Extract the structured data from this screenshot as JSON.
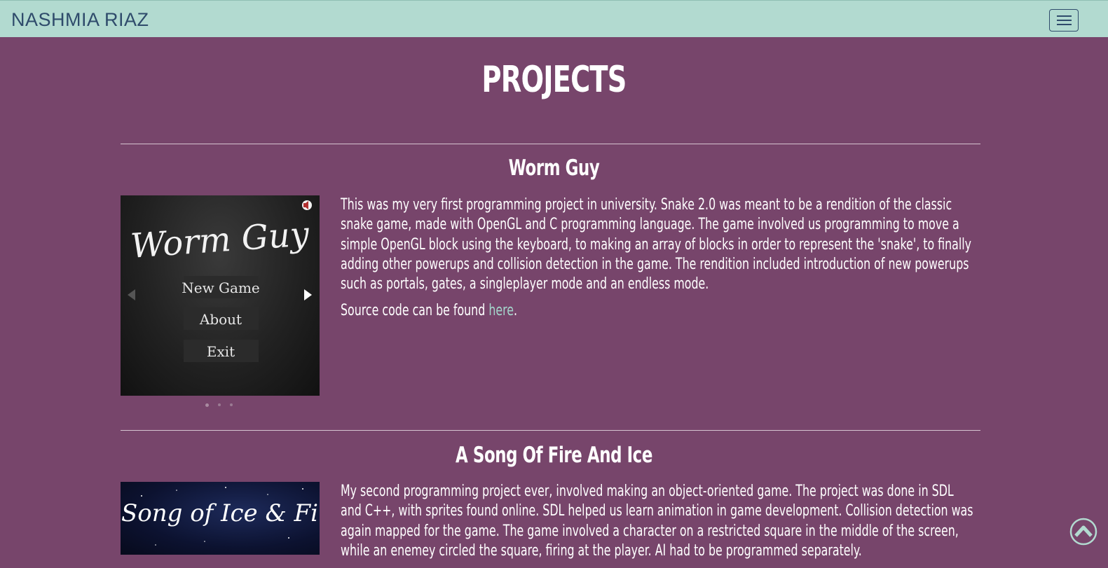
{
  "navbar": {
    "brand": "NASHMIA RIAZ",
    "menu_icon": "hamburger-menu-icon"
  },
  "page_title": "PROJECTS",
  "projects": [
    {
      "title": "Worm Guy",
      "image": {
        "game_title": "Worm Guy",
        "menu": [
          "New Game",
          "About",
          "Exit"
        ],
        "icons": [
          "mute-icon",
          "previous-arrow-icon",
          "next-arrow-icon"
        ]
      },
      "description": "This was my very first programming project in university. Snake 2.0 was meant to be a rendition of the classic snake game, made with OpenGL and C programming language. The game involved us programming to move a simple OpenGL block using the keyboard, to making an array of blocks in order to represent the 'snake', to finally adding other powerups and collision detection in the game. The rendition included introduction of new powerups such as portals, gates, a singleplayer mode and an endless mode.",
      "source_prefix": "Source code can be found ",
      "source_link": "here",
      "source_suffix": "."
    },
    {
      "title": "A Song Of Fire And Ice",
      "image": {
        "game_title": "A Song of Ice & Fire"
      },
      "description": "My second programming project ever, involved making an object-oriented game. The project was done in SDL and C++, with sprites found online. SDL helped us learn animation in game development. Collision detection was again mapped for the game. The game involved a character on a restricted square in the middle of the screen, while an enemey circled the square, firing at the player. AI had to be programmed separately."
    }
  ],
  "carousel": {
    "slide_count": 3,
    "active_index": 0
  },
  "scroll_top_icon": "scroll-to-top-icon",
  "colors": {
    "background": "#77456b",
    "navbar": "#b2dad0",
    "brand_text": "#2f4b6b",
    "link": "#a4d6cc"
  }
}
